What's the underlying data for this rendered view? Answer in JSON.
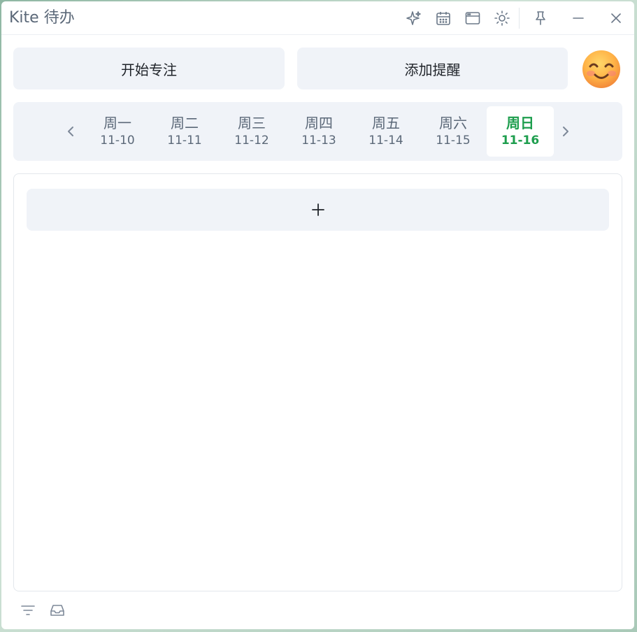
{
  "window": {
    "title": "Kite 待办"
  },
  "actions": {
    "focus_label": "开始专注",
    "reminder_label": "添加提醒"
  },
  "week": {
    "days": [
      {
        "name": "周一",
        "date": "11-10"
      },
      {
        "name": "周二",
        "date": "11-11"
      },
      {
        "name": "周三",
        "date": "11-12"
      },
      {
        "name": "周四",
        "date": "11-13"
      },
      {
        "name": "周五",
        "date": "11-14"
      },
      {
        "name": "周六",
        "date": "11-15"
      },
      {
        "name": "周日",
        "date": "11-16"
      }
    ],
    "selected": "周日"
  },
  "tasks": {
    "add_symbol": "+"
  },
  "colors": {
    "accent": "#1e9e4e",
    "muted_text": "#5b6878",
    "surface": "#f0f3f8"
  },
  "icons": {
    "titlebar": [
      "sparkle-icon",
      "calendar-icon",
      "window-icon",
      "sun-icon",
      "pin-icon",
      "minimize-icon",
      "close-icon"
    ],
    "week_nav": [
      "chevron-left-icon",
      "chevron-right-icon"
    ],
    "bottom": [
      "filter-icon",
      "inbox-icon"
    ],
    "avatar": "smiling-face-emoji"
  }
}
